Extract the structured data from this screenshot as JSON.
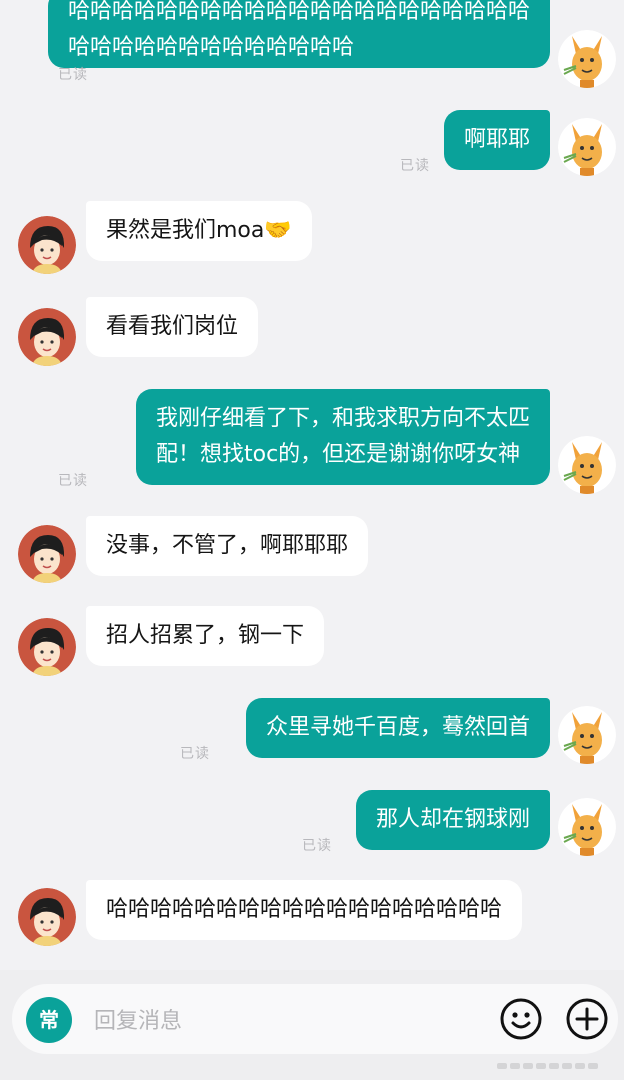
{
  "messages": [
    {
      "side": "out",
      "read": "已读",
      "lines": [
        "哈哈哈哈哈哈哈哈哈哈哈哈哈哈哈哈哈哈哈哈哈",
        "哈哈哈哈哈哈哈哈哈哈哈哈哈"
      ]
    },
    {
      "side": "out",
      "read": "已读",
      "lines": [
        "啊耶耶"
      ]
    },
    {
      "side": "in",
      "lines": [
        "果然是我们moa🤝"
      ]
    },
    {
      "side": "in",
      "lines": [
        "看看我们岗位"
      ]
    },
    {
      "side": "out",
      "read": "已读",
      "lines": [
        "我刚仔细看了下，和我求职方向不太匹",
        "配！想找toc的，但还是谢谢你呀女神"
      ]
    },
    {
      "side": "in",
      "lines": [
        "没事，不管了，啊耶耶耶"
      ]
    },
    {
      "side": "in",
      "lines": [
        "招人招累了，钢一下"
      ]
    },
    {
      "side": "out",
      "read": "已读",
      "lines": [
        "众里寻她千百度，蓦然回首"
      ]
    },
    {
      "side": "out",
      "read": "已读",
      "lines": [
        "那人却在钢球刚"
      ]
    },
    {
      "side": "in",
      "lines": [
        "哈哈哈哈哈哈哈哈哈哈哈哈哈哈哈哈哈哈"
      ]
    }
  ],
  "composer": {
    "mode_label": "常",
    "placeholder": "回复消息",
    "emoji_icon": "smiley-icon",
    "plus_icon": "plus-circle-icon"
  },
  "colors": {
    "outgoing_bubble": "#0aa29a",
    "incoming_bubble": "#ffffff",
    "background": "#f2f2f4"
  }
}
